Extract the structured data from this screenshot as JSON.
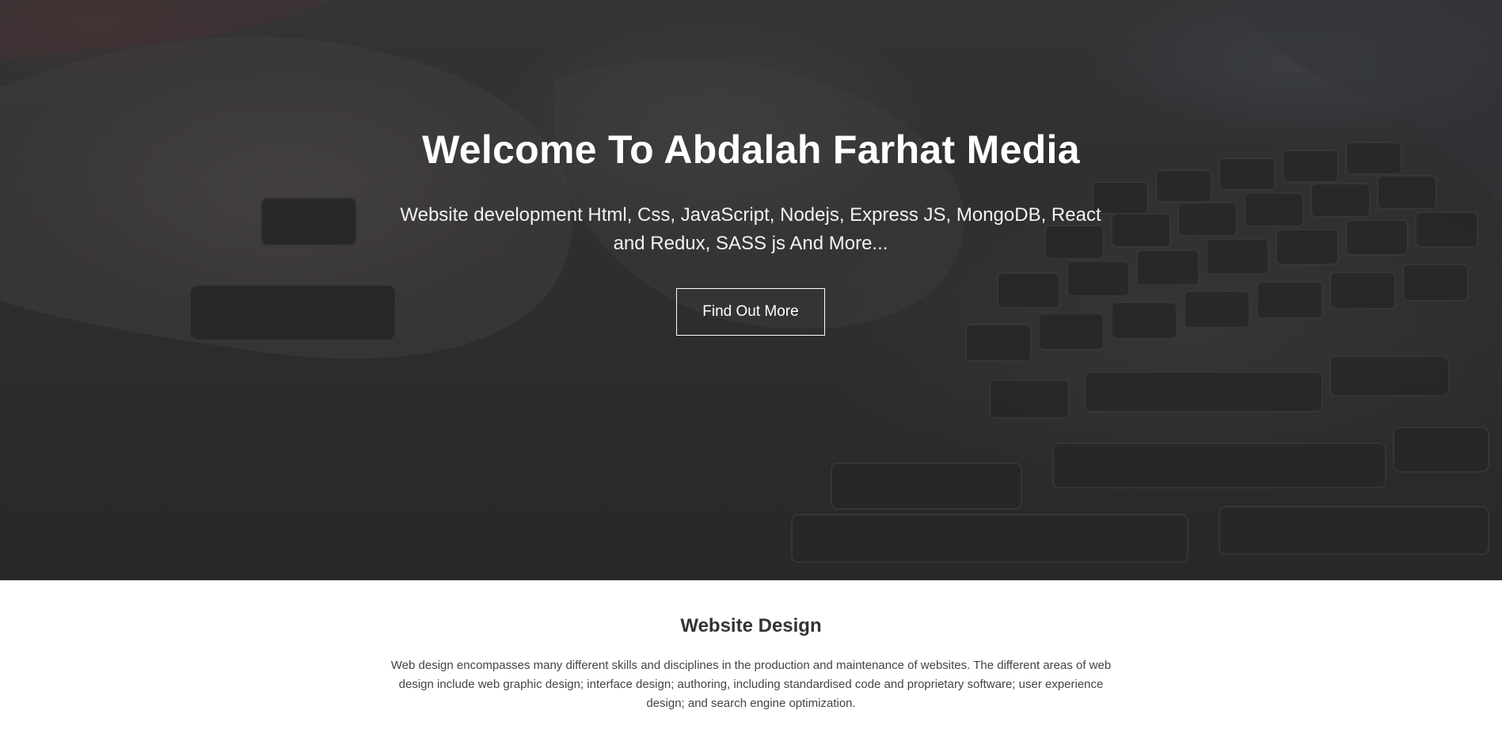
{
  "hero": {
    "title": "Welcome To Abdalah Farhat Media",
    "subtitle": "Website development Html, Css, JavaScript, Nodejs, Express JS, MongoDB, React and Redux, SASS js And More...",
    "cta_label": "Find Out More"
  },
  "section": {
    "title": "Website Design",
    "text": "Web design encompasses many different skills and disciplines in the production and maintenance of websites. The different areas of web design include web graphic design; interface design; authoring, including standardised code and proprietary software; user experience design; and search engine optimization."
  },
  "colors": {
    "hero_bg": "#333234",
    "text_light": "#ffffff",
    "section_title": "#333333",
    "section_text": "#444444"
  },
  "background_image": "hands-typing-on-keyboard"
}
